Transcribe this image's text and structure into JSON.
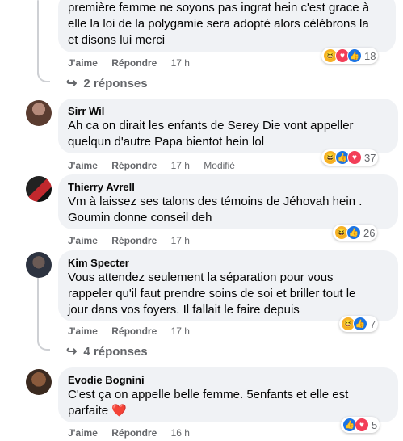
{
  "comments": [
    {
      "author": "",
      "lines": [
        "première femme ne soyons pas ingrat hein c'est grace à",
        "elle la loi de la polygamie sera adopté alors célébrons la",
        "et disons lui merci"
      ],
      "like": "J'aime",
      "reply": "Répondre",
      "time": "17 h",
      "reactions_count": "18",
      "reactions": [
        "haha-icon",
        "love-icon",
        "like-icon"
      ]
    },
    {
      "author": "Sirr Wil",
      "lines": [
        "Ah ca on dirait les enfants de Serey Die vont appeller",
        "quelqun d'autre Papa bientot hein lol"
      ],
      "like": "J'aime",
      "reply": "Répondre",
      "time": "17 h",
      "edited": "Modifié",
      "reactions_count": "37",
      "reactions": [
        "haha-icon",
        "like-icon",
        "love-icon"
      ]
    },
    {
      "author": "Thierry Avrell",
      "lines": [
        "Vm à laissez ses talons des témoins de Jéhovah hein .",
        "Goumin donne conseil deh"
      ],
      "like": "J'aime",
      "reply": "Répondre",
      "time": "17 h",
      "reactions_count": "26",
      "reactions": [
        "haha-icon",
        "like-icon"
      ]
    },
    {
      "author": "Kim Specter",
      "lines": [
        "Vous attendez seulement la séparation pour vous",
        "rappeler qu'il faut prendre soins de soi et briller tout le",
        "jour dans vos foyers. Il fallait le faire depuis"
      ],
      "like": "J'aime",
      "reply": "Répondre",
      "time": "17 h",
      "reactions_count": "7",
      "reactions": [
        "haha-icon",
        "like-icon"
      ]
    },
    {
      "author": "Evodie Bognini",
      "lines": [
        "C'est ça on appelle belle femme. 5enfants et elle est",
        "parfaite ❤️"
      ],
      "like": "J'aime",
      "reply": "Répondre",
      "time": "16 h",
      "reactions_count": "5",
      "reactions": [
        "like-icon",
        "love-icon"
      ]
    }
  ],
  "reply_threads": [
    {
      "label": "2 réponses"
    },
    {
      "label": "4 réponses"
    }
  ],
  "colors": {
    "bubble": "#f0f2f5",
    "meta": "#65676b",
    "like": "#1b74e4",
    "love": "#f33e58",
    "haha": "#f7b125"
  }
}
